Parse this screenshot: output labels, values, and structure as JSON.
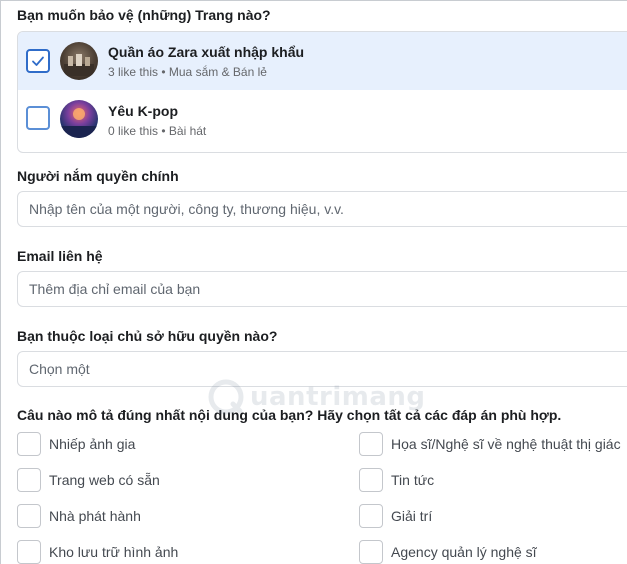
{
  "protect_pages": {
    "question": "Bạn muốn bảo vệ (những) Trang nào?",
    "pages": [
      {
        "name": "Quần áo Zara xuất nhập khẩu",
        "meta": "3 like this • Mua sắm & Bán lẻ",
        "checked": true
      },
      {
        "name": "Yêu K-pop",
        "meta": "0 like this • Bài hát",
        "checked": false
      }
    ]
  },
  "owner": {
    "label": "Người nắm quyền chính",
    "placeholder": "Nhập tên của một người, công ty, thương hiệu, v.v."
  },
  "email": {
    "label": "Email liên hệ",
    "placeholder": "Thêm địa chỉ email của bạn"
  },
  "owner_type": {
    "label": "Bạn thuộc loại chủ sở hữu quyền nào?",
    "selected": "Chọn một"
  },
  "content_type": {
    "question": "Câu nào mô tả đúng nhất nội dung của bạn? Hãy chọn tất cả các đáp án phù hợp.",
    "options_left": [
      "Nhiếp ảnh gia",
      "Trang web có sẵn",
      "Nhà phát hành",
      "Kho lưu trữ hình ảnh"
    ],
    "options_right": [
      "Họa sĩ/Nghệ sĩ về nghệ thuật thị giác",
      "Tin tức",
      "Giải trí",
      "Agency quản lý nghệ sĩ"
    ]
  },
  "watermark": {
    "text": "uantrimang"
  },
  "colors": {
    "accent": "#2f6cc9",
    "selected_row": "#e7f0fd",
    "border": "#dadde1"
  }
}
